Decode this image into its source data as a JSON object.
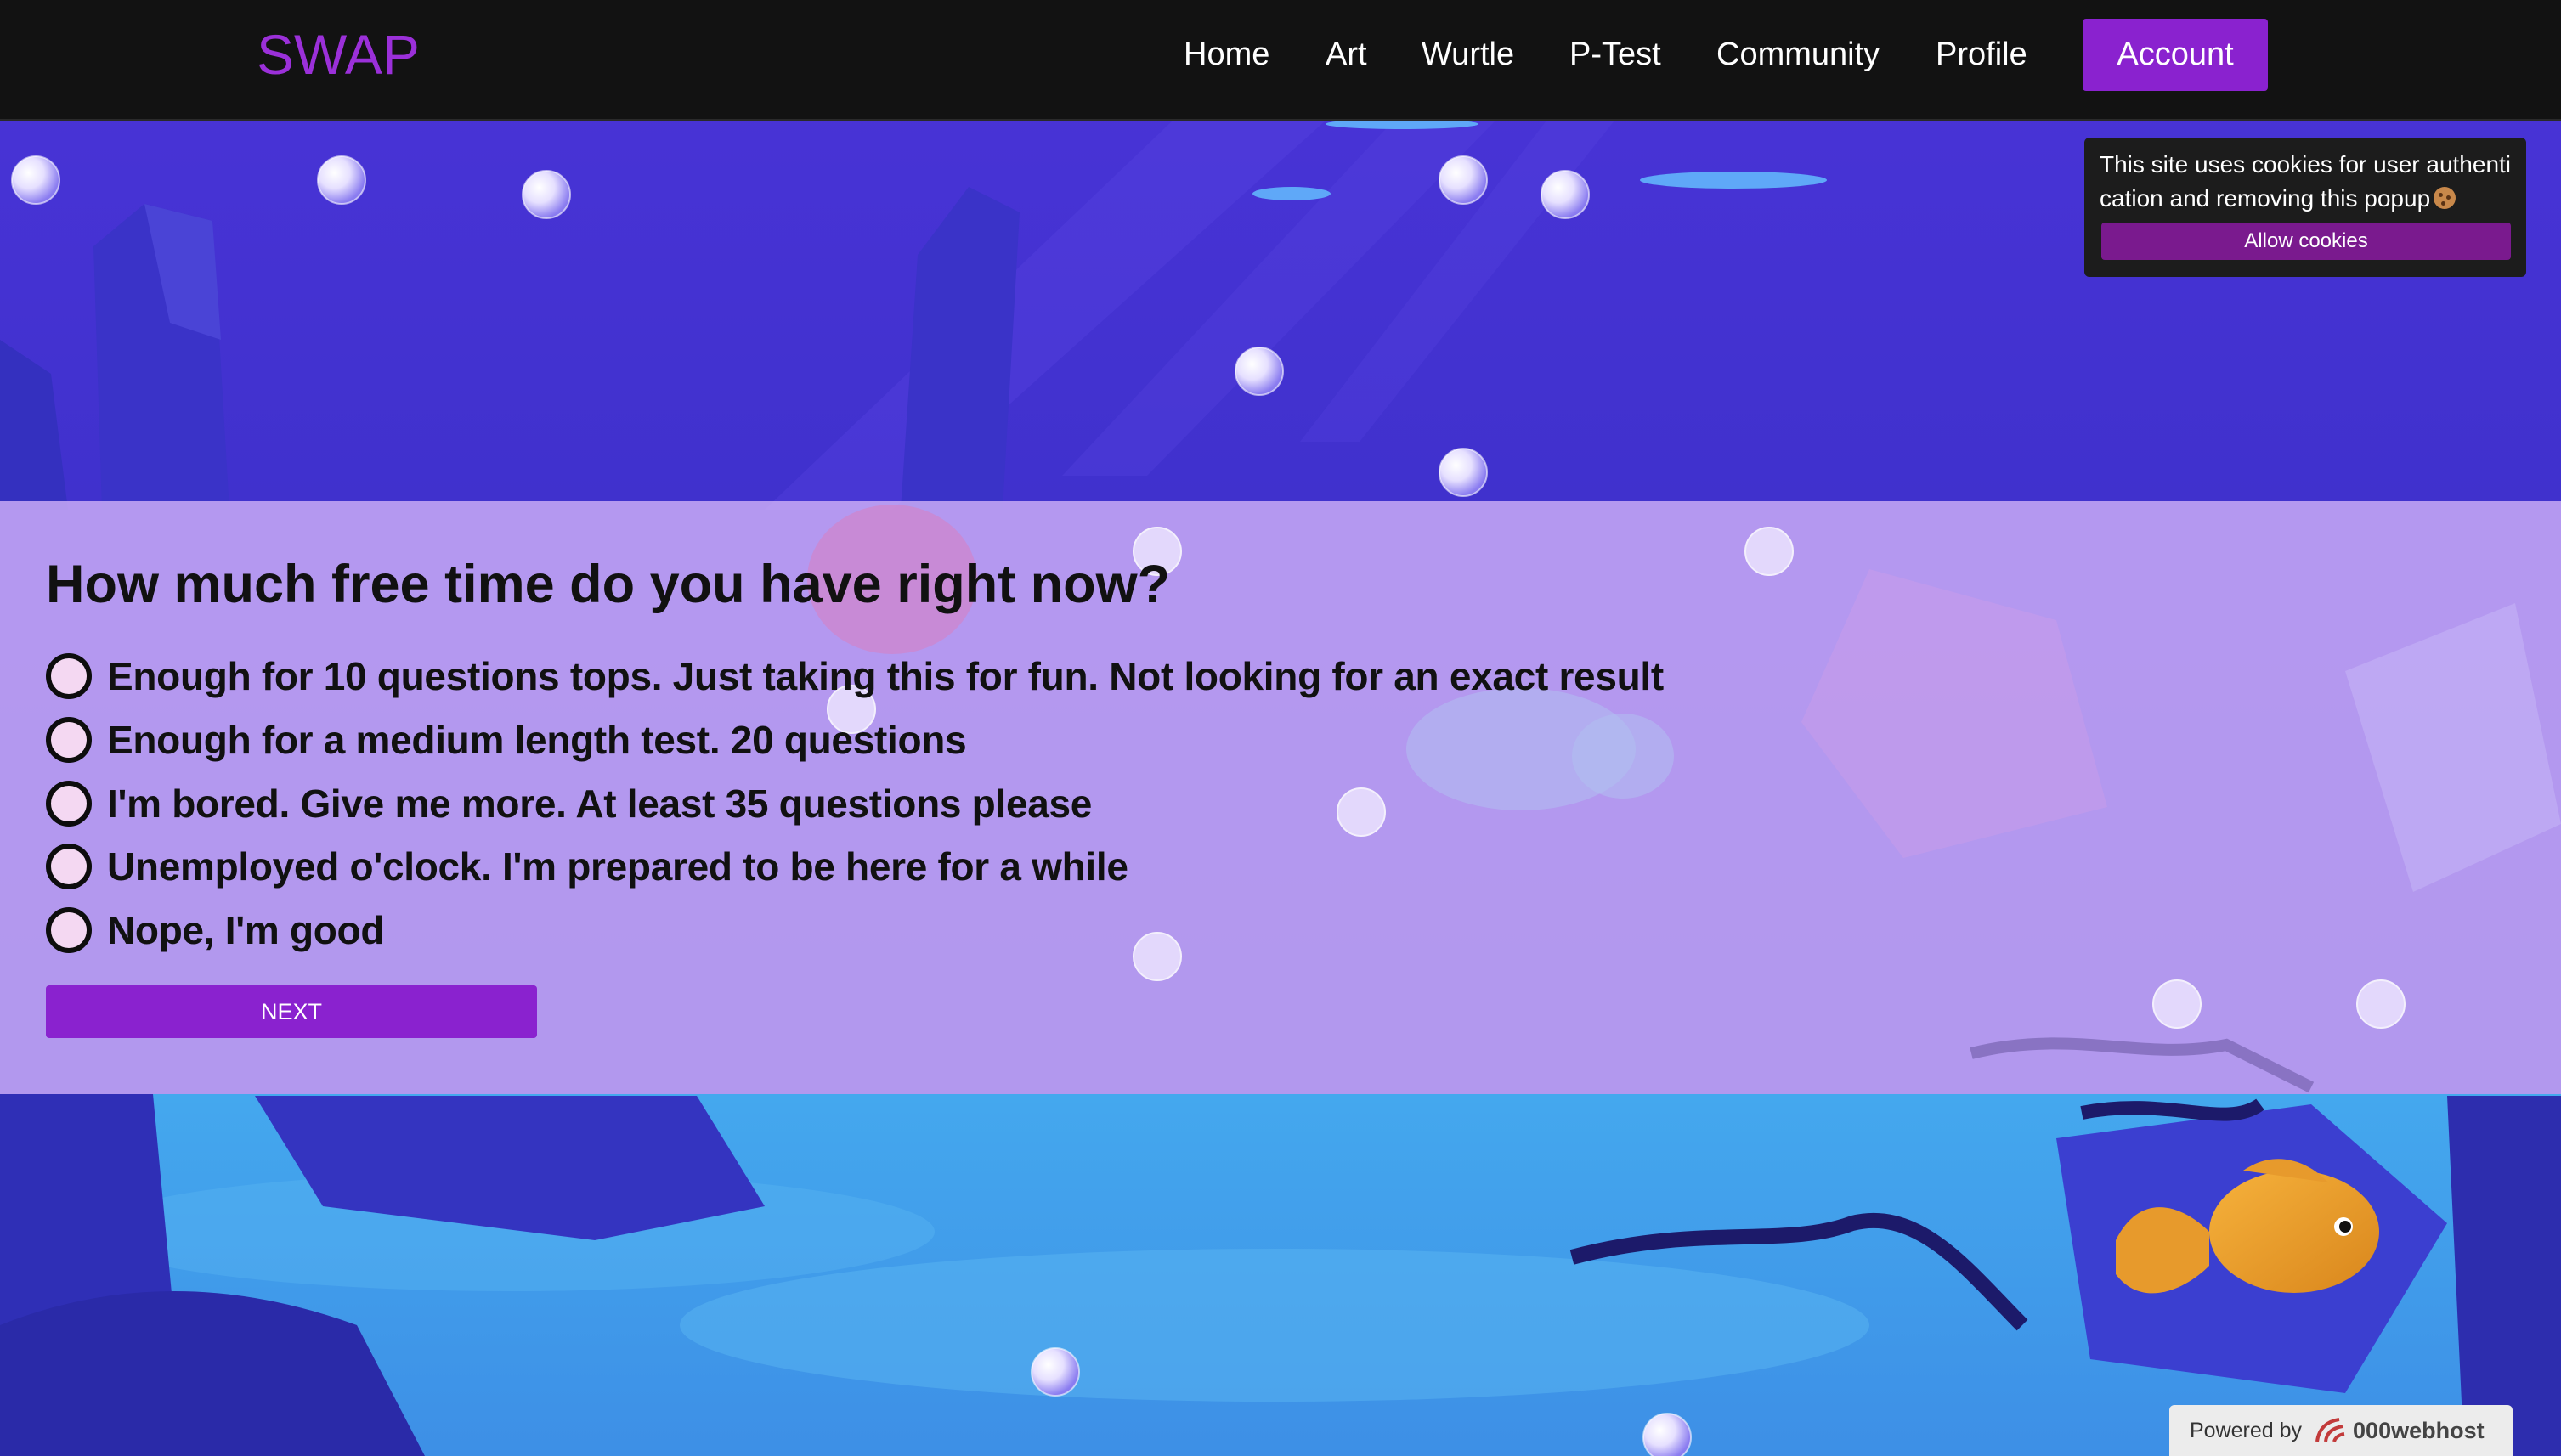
{
  "navbar": {
    "brand": "SWAP",
    "links": [
      "Home",
      "Art",
      "Wurtle",
      "P-Test",
      "Community",
      "Profile"
    ],
    "account": "Account"
  },
  "cookie_popup": {
    "text": "This site uses cookies for user authentication and removing this popup",
    "button": "Allow cookies"
  },
  "quiz": {
    "question": "How much free time do you have right now?",
    "options": [
      "Enough for 10 questions tops. Just taking this for fun. Not looking for an exact result",
      "Enough for a medium length test. 20 questions",
      "I'm bored. Give me more. At least 35 questions please",
      "Unemployed o'clock. I'm prepared to be here for a while",
      "Nope, I'm good"
    ],
    "next_button": "NEXT"
  },
  "footer": {
    "powered_by": "Powered by",
    "host": "000webhost"
  },
  "colors": {
    "accent": "#8a22cf",
    "brand": "#9b30d9",
    "navbar_bg": "#121212",
    "panel_bg": "#ceb0f8"
  }
}
